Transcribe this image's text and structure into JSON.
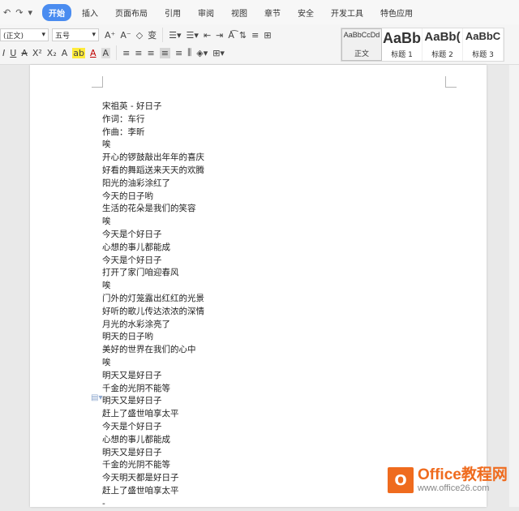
{
  "quick_access": {
    "undo_icon": "↶",
    "redo_icon": "↷",
    "more_icon": "▾"
  },
  "menu_tabs": [
    {
      "label": "开始",
      "active": true
    },
    {
      "label": "插入",
      "active": false
    },
    {
      "label": "页面布局",
      "active": false
    },
    {
      "label": "引用",
      "active": false
    },
    {
      "label": "审阅",
      "active": false
    },
    {
      "label": "视图",
      "active": false
    },
    {
      "label": "章节",
      "active": false
    },
    {
      "label": "安全",
      "active": false
    },
    {
      "label": "开发工具",
      "active": false
    },
    {
      "label": "特色应用",
      "active": false
    }
  ],
  "ribbon": {
    "font_name": "(正文)",
    "font_size": "五号",
    "increase_font": "A⁺",
    "decrease_font": "A⁻",
    "eraser": "◇",
    "phonetic": "变",
    "italic": "I",
    "underline": "U",
    "strikethrough": "A",
    "superscript": "X²",
    "subscript": "X₂",
    "text_effect": "A",
    "highlight": "ab",
    "font_color": "A",
    "char_shading": "A"
  },
  "styles": [
    {
      "preview": "AaBbCcDd",
      "name": "正文",
      "selected": true,
      "size": "9px",
      "bold": false
    },
    {
      "preview": "AaBb",
      "name": "标题 1",
      "selected": false,
      "size": "18px",
      "bold": true
    },
    {
      "preview": "AaBb(",
      "name": "标题 2",
      "selected": false,
      "size": "15px",
      "bold": true
    },
    {
      "preview": "AaBbC",
      "name": "标题 3",
      "selected": false,
      "size": "13px",
      "bold": true
    }
  ],
  "document": {
    "lines": [
      "宋祖英 - 好日子",
      "作词：车行",
      "作曲：李昕",
      "唉",
      "开心的锣鼓敲出年年的喜庆",
      "好看的舞蹈送来天天的欢腾",
      "阳光的油彩涂红了",
      "今天的日子哟",
      "生活的花朵是我们的笑容",
      "唉",
      "今天是个好日子",
      "心想的事儿都能成",
      "今天是个好日子",
      "打开了家门咱迎春风",
      "唉",
      "门外的灯笼露出红红的光景",
      "好听的歌儿传达浓浓的深情",
      "月光的水彩涂亮了",
      "明天的日子哟",
      "美好的世界在我们的心中",
      "唉",
      "明天又是好日子",
      "千金的光阴不能等",
      "明天又是好日子",
      "赶上了盛世咱享太平",
      "今天是个好日子",
      "心想的事儿都能成",
      "明天又是好日子",
      "千金的光阴不能等",
      "今天明天都是好日子",
      "赶上了盛世咱享太平",
      "-"
    ]
  },
  "watermark": {
    "logo_letter": "O",
    "brand": "Office教程网",
    "url": "www.office26.com"
  }
}
